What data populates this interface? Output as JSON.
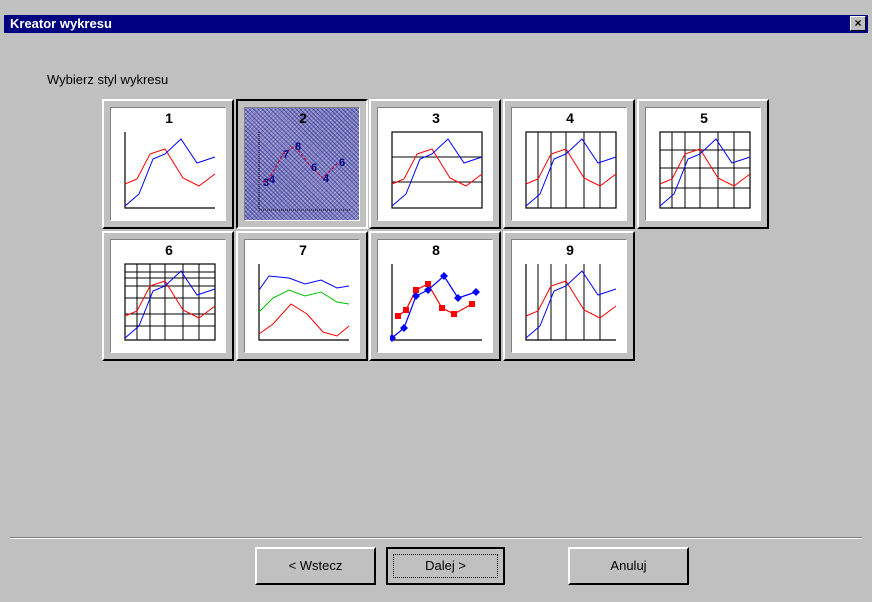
{
  "window": {
    "title": "Kreator wykresu",
    "close_glyph": "×"
  },
  "prompt": "Wybierz styl wykresu",
  "styles": [
    {
      "number": "1"
    },
    {
      "number": "2",
      "selected": true
    },
    {
      "number": "3"
    },
    {
      "number": "4"
    },
    {
      "number": "5"
    },
    {
      "number": "6"
    },
    {
      "number": "7"
    },
    {
      "number": "8"
    },
    {
      "number": "9"
    }
  ],
  "sample_labels": [
    "3",
    "4",
    "7",
    "8",
    "6",
    "4",
    "6"
  ],
  "buttons": {
    "back": "< Wstecz",
    "next": "Dalej >",
    "cancel": "Anuluj"
  },
  "colors": {
    "title_bar": "#000080",
    "selection": "#000080",
    "line_red": "#ff0000",
    "line_blue": "#0000ff",
    "line_green": "#00c000"
  }
}
